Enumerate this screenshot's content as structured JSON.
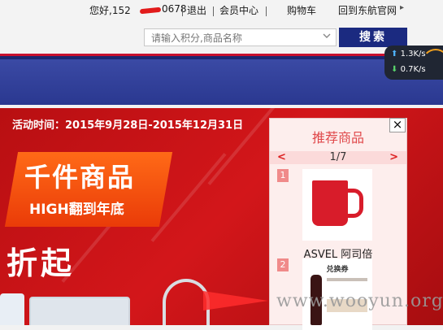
{
  "header": {
    "greeting": "您好,152",
    "phone_tail": "0678",
    "logout": "退出",
    "member_center": "会员中心",
    "cart": "购物车",
    "back_home": "回到东航官网",
    "arrow": "▸"
  },
  "search": {
    "placeholder": "请输入积分,商品名称",
    "button": "搜索",
    "dropdown_icon": "chevron-down-icon"
  },
  "speed_meter": {
    "up": "1.3K/s",
    "down": "0.7K/s",
    "up_icon": "arrow-up-icon",
    "down_icon": "arrow-down-icon"
  },
  "banner": {
    "activity_time": "活动时间：2015年9月28日-2015年12月31日",
    "badge_line1": "千件商品",
    "badge_line2": "HIGH翻到年底",
    "discount": "折起"
  },
  "recommend": {
    "title": "推荐商品",
    "close": "×",
    "pager": {
      "prev": "<",
      "count": "1/7",
      "next": ">"
    },
    "items": [
      {
        "num": "1",
        "name": "ASVEL 阿司倍",
        "image": "red-mug-image"
      },
      {
        "num": "2",
        "voucher_title": "兑换券",
        "image": "wine-voucher-image"
      }
    ]
  },
  "watermark": "www.wooyun.org",
  "colors": {
    "brand_blue": "#1b2a80",
    "banner_red": "#c8102e",
    "badge_orange": "#f2570e",
    "recommend_title": "#e0484a"
  }
}
